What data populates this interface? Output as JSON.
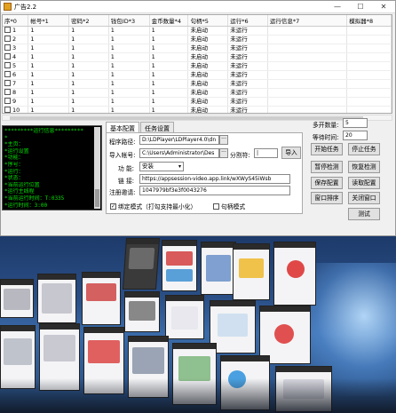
{
  "window": {
    "title": "广告2.2",
    "min_label": "—",
    "max_label": "☐",
    "close_label": "✕"
  },
  "table": {
    "headers": [
      "序*0",
      "帐号*1",
      "密码*2",
      "钱包ID*3",
      "金币数量*4",
      "句柄*5",
      "运行*6",
      "运行信息*7",
      "模拟器*8"
    ],
    "rows": [
      [
        "1",
        "1",
        "1",
        "1",
        "1",
        "未启动",
        "未运行",
        "",
        ""
      ],
      [
        "2",
        "1",
        "1",
        "1",
        "1",
        "未启动",
        "未运行",
        "",
        ""
      ],
      [
        "3",
        "1",
        "1",
        "1",
        "1",
        "未启动",
        "未运行",
        "",
        ""
      ],
      [
        "4",
        "1",
        "1",
        "1",
        "1",
        "未启动",
        "未运行",
        "",
        ""
      ],
      [
        "5",
        "1",
        "1",
        "1",
        "1",
        "未启动",
        "未运行",
        "",
        ""
      ],
      [
        "6",
        "1",
        "1",
        "1",
        "1",
        "未启动",
        "未运行",
        "",
        ""
      ],
      [
        "7",
        "1",
        "1",
        "1",
        "1",
        "未启动",
        "未运行",
        "",
        ""
      ],
      [
        "8",
        "1",
        "1",
        "1",
        "1",
        "未启动",
        "未运行",
        "",
        ""
      ],
      [
        "9",
        "1",
        "1",
        "1",
        "1",
        "未启动",
        "未运行",
        "",
        ""
      ],
      [
        "10",
        "1",
        "1",
        "1",
        "1",
        "未启动",
        "未运行",
        "",
        ""
      ]
    ]
  },
  "console": {
    "lines": [
      "*********运行信息*********",
      "*",
      "*主页：",
      "*运行设置",
      "*功能：",
      "*序号：",
      "*运行：",
      "*状态：",
      "",
      "*当前运行位置",
      "*运行主线程",
      "*当前运行时间：T:0335",
      "*运行时间：3:00"
    ]
  },
  "tabs": {
    "basic": "基本配置",
    "task": "任务设置"
  },
  "form": {
    "program_path_label": "程序路径:",
    "program_path_value": "D:\\LDPlayer\\LDPlayer4.0\\dn",
    "import_account_label": "导入帐号:",
    "import_account_value": "C:\\Users\\Administrator\\Des",
    "separator_label": "分割符:",
    "separator_value": "|",
    "import_button": "导入",
    "function_label": "功  能:",
    "function_value": "安装",
    "link_label": "链  接:",
    "link_value": "https://appsession-video.app.link/wXWyS45iWsb",
    "register_code_label": "注册邀请:",
    "register_code_value": "1047979bf3e3f0043276",
    "bind_mode_label": "绑定模式（打勾支持最小化）",
    "handle_mode_label": "句柄模式",
    "dots": "···"
  },
  "right": {
    "open_count_label": "多开数量:",
    "open_count_value": "5",
    "wait_time_label": "等待时间:",
    "wait_time_value": "20",
    "start_task": "开始任务",
    "stop_task": "停止任务",
    "pause_detect": "暂停检测",
    "resume_detect": "恢复检测",
    "save_config": "保存配置",
    "read_config": "读取配置",
    "window_sort": "窗口排序",
    "close_window": "关闭窗口",
    "test": "测试"
  },
  "colors": {
    "console_bg": "#000000",
    "console_text": "#00e000",
    "window_bg": "#f0f0f0"
  }
}
